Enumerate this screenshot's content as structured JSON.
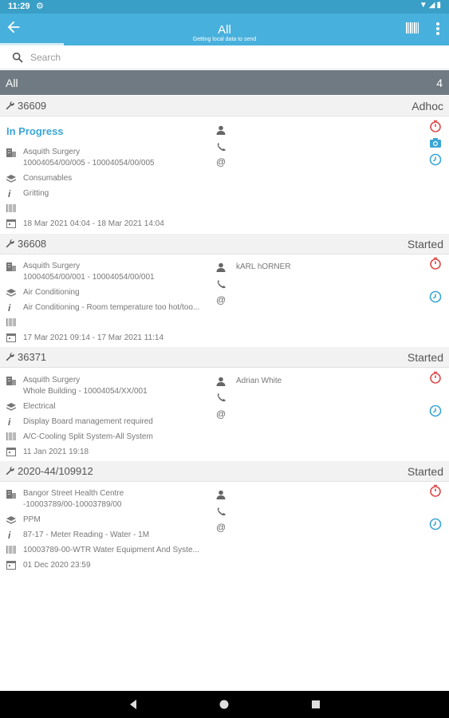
{
  "status_bar": {
    "time": "11:29"
  },
  "app_bar": {
    "title": "All",
    "subtitle": "Getting local data to send"
  },
  "search": {
    "placeholder": "Search"
  },
  "group": {
    "label": "All",
    "count": "4"
  },
  "jobs": [
    {
      "number": "36609",
      "status": "Adhoc",
      "progress": "In Progress",
      "site": "Asquith Surgery",
      "location": "10004054/00/005 - 10004054/00/005",
      "category": "Consumables",
      "info": "Gritting",
      "asset": "",
      "date": "18 Mar 2021 04:04 - 18 Mar 2021 14:04",
      "contact": ""
    },
    {
      "number": "36608",
      "status": "Started",
      "site": "Asquith Surgery",
      "location": "10004054/00/001 - 10004054/00/001",
      "category": "Air Conditioning",
      "info": "Air Conditioning - Room temperature too hot/too...",
      "asset": "",
      "date": "17 Mar 2021 09:14 - 17 Mar 2021 11:14",
      "contact": "kARL hORNER"
    },
    {
      "number": "36371",
      "status": "Started",
      "site": "Asquith Surgery",
      "location": "Whole Building - 10004054/XX/001",
      "category": "Electrical",
      "info": "Display Board management required",
      "asset": "A/C-Cooling Split System-All System",
      "date": "11 Jan 2021 19:18",
      "contact": "Adrian White"
    },
    {
      "number": "2020-44/109912",
      "status": "Started",
      "site": "Bangor Street Health Centre",
      "location": "-10003789/00-10003789/00",
      "category": "PPM",
      "info": "87-17 - Meter Reading - Water - 1M",
      "asset": "10003789-00-WTR   Water Equipment And Syste...",
      "date": "01 Dec 2020 23:59",
      "contact": ""
    }
  ],
  "colors": {
    "app_bar": "#48b0dc",
    "status_bar": "#3a9fc6",
    "group_header": "#6f7a82",
    "accent": "#3aa6d6",
    "alert": "#e04a4a"
  },
  "icons": [
    "back-arrow-icon",
    "barcode-icon",
    "more-vert-icon",
    "search-icon",
    "wrench-icon",
    "building-icon",
    "layers-icon",
    "info-icon",
    "barcode-small-icon",
    "calendar-icon",
    "person-icon",
    "phone-icon",
    "at-icon",
    "timer-icon",
    "camera-icon",
    "clock-icon"
  ]
}
